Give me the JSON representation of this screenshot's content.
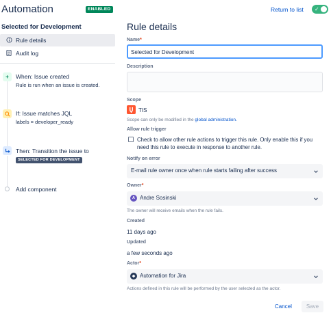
{
  "header": {
    "title": "Automation",
    "status_badge": "ENABLED",
    "return_link": "Return to list",
    "toggle_on": true,
    "accent_color": "#36b37e"
  },
  "sidebar": {
    "title": "Selected for Development",
    "nav": [
      {
        "label": "Rule details",
        "icon": "info-icon",
        "active": true
      },
      {
        "label": "Audit log",
        "icon": "document-icon",
        "active": false
      }
    ],
    "flow": [
      {
        "icon": "plus-icon",
        "title": "When: Issue created",
        "subtitle": "Rule is run when an issue is created."
      },
      {
        "icon": "search-icon",
        "title": "If: Issue matches JQL",
        "subtitle": "labels = developer_ready"
      },
      {
        "icon": "transition-icon",
        "title": "Then: Transition the issue to",
        "badge": "SELECTED FOR DEVELOPMENT"
      }
    ],
    "add_component": "Add component"
  },
  "main": {
    "title": "Rule details",
    "name_label": "Name",
    "name_value": "Selected for Development",
    "description_label": "Description",
    "description_value": "",
    "scope_label": "Scope",
    "scope_project": "TIS",
    "scope_helper_prefix": "Scope can only be modified in the",
    "scope_helper_link": "global administration.",
    "allow_trigger_label": "Allow rule trigger",
    "allow_trigger_text": "Check to allow other rule actions to trigger this rule. Only enable this if you need this rule to execute in response to another rule.",
    "allow_trigger_checked": false,
    "notify_label": "Notify on error",
    "notify_value": "E-mail rule owner once when rule starts failing after success",
    "owner_label": "Owner",
    "owner_value": "Andre Sosinski",
    "owner_helper": "The owner will receive emails when the rule fails.",
    "created_label": "Created",
    "created_value": "11 days ago",
    "updated_label": "Updated",
    "updated_value": "a few seconds ago",
    "actor_label": "Actor",
    "actor_value": "Automation for Jira",
    "actor_helper": "Actions defined in this rule will be performed by the user selected as the actor.",
    "cancel_label": "Cancel",
    "save_label": "Save",
    "required_mark": "*"
  }
}
